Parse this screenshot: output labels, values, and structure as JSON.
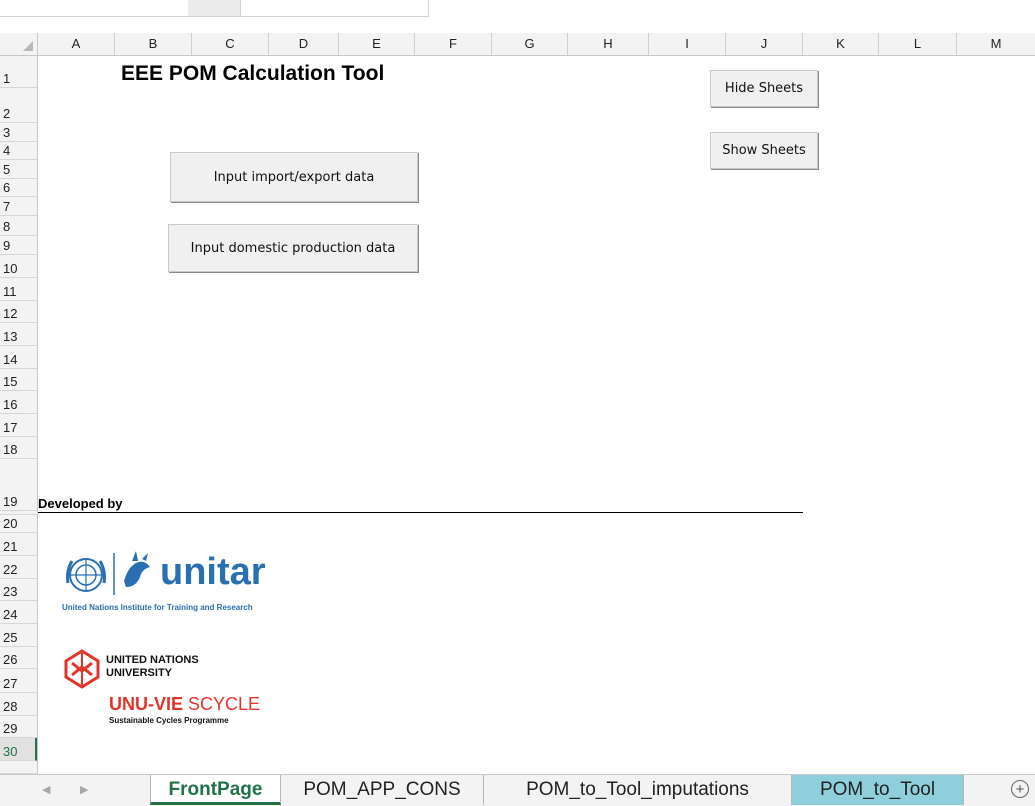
{
  "columns": [
    "A",
    "B",
    "C",
    "D",
    "E",
    "F",
    "G",
    "H",
    "I",
    "J",
    "K",
    "L",
    "M"
  ],
  "rows": [
    "1",
    "2",
    "3",
    "4",
    "5",
    "6",
    "7",
    "8",
    "9",
    "10",
    "11",
    "12",
    "13",
    "14",
    "15",
    "16",
    "17",
    "18",
    "19",
    "20",
    "21",
    "22",
    "23",
    "24",
    "25",
    "26",
    "27",
    "28",
    "29",
    "30"
  ],
  "selected_row": "30",
  "sheet": {
    "title": "EEE POM Calculation Tool",
    "developed_by": "Developed by"
  },
  "buttons": {
    "hide_sheets": "Hide Sheets",
    "show_sheets": "Show Sheets",
    "input_import_export": "Input import/export data",
    "input_domestic": "Input domestic production data"
  },
  "logos": {
    "unitar_word": "unitar",
    "unitar_subtitle": "United Nations Institute for Training and Research",
    "unu_line1": "UNITED NATIONS",
    "unu_line2": "UNIVERSITY",
    "scycle_bold": "UNU-VIE",
    "scycle_rest": " SCYCLE",
    "scycle_subtitle": "Sustainable Cycles Programme",
    "unitar_color": "#2a6fb2",
    "unu_red": "#e2352a"
  },
  "tabs": [
    {
      "label": "FrontPage",
      "active": true
    },
    {
      "label": "POM_APP_CONS",
      "active": false
    },
    {
      "label": "POM_to_Tool_imputations",
      "active": false
    },
    {
      "label": "POM_to_Tool",
      "active": false,
      "color": "#8fcfdc"
    }
  ],
  "add_sheet_symbol": "+",
  "accent": "#217346"
}
